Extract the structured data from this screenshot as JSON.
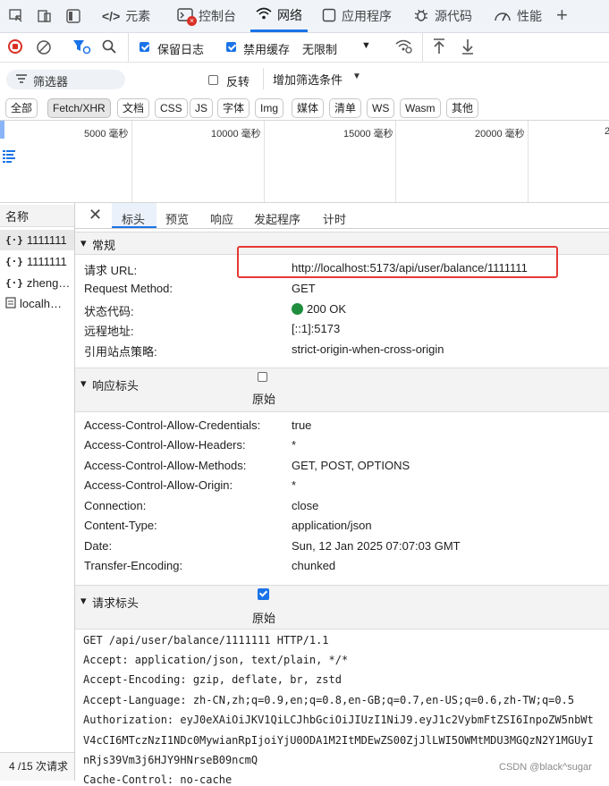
{
  "tabs": [
    {
      "label": "元素",
      "icon": "code-brackets-icon"
    },
    {
      "label": "控制台",
      "icon": "console-icon"
    },
    {
      "label": "网络",
      "icon": "wifi-icon"
    },
    {
      "label": "应用程序",
      "icon": "app-icon"
    },
    {
      "label": "源代码",
      "icon": "bug-icon"
    },
    {
      "label": "性能",
      "icon": "gauge-icon"
    }
  ],
  "toolbar": {
    "preserve_log": "保留日志",
    "disable_cache": "禁用缓存",
    "throttle": "无限制"
  },
  "filter": {
    "placeholder": "筛选器",
    "invert": "反转",
    "more": "增加筛选条件"
  },
  "types": [
    "全部",
    "Fetch/XHR",
    "文档",
    "CSS",
    "JS",
    "字体",
    "Img",
    "媒体",
    "清单",
    "WS",
    "Wasm",
    "其他"
  ],
  "timeline": {
    "ticks": [
      "5000 毫秒",
      "10000 毫秒",
      "15000 毫秒",
      "20000 毫秒",
      "2"
    ]
  },
  "left": {
    "header": "名称",
    "rows": [
      "1111111",
      "1111111",
      "zheng…",
      "localh…"
    ],
    "status": "4 /15 次请求"
  },
  "detail_tabs": [
    "标头",
    "预览",
    "响应",
    "发起程序",
    "计时"
  ],
  "general": {
    "title": "常规",
    "rows": [
      {
        "name": "请求 URL:",
        "value": "http://localhost:5173/api/user/balance/1111111"
      },
      {
        "name": "Request Method:",
        "value": "GET"
      },
      {
        "name": "状态代码:",
        "value": "200 OK"
      },
      {
        "name": "远程地址:",
        "value": "[::1]:5173"
      },
      {
        "name": "引用站点策略:",
        "value": "strict-origin-when-cross-origin"
      }
    ]
  },
  "response_headers": {
    "title": "响应标头",
    "raw_label": "原始",
    "rows": [
      {
        "name": "Access-Control-Allow-Credentials:",
        "value": "true"
      },
      {
        "name": "Access-Control-Allow-Headers:",
        "value": "*"
      },
      {
        "name": "Access-Control-Allow-Methods:",
        "value": "GET, POST, OPTIONS"
      },
      {
        "name": "Access-Control-Allow-Origin:",
        "value": "*"
      },
      {
        "name": "Connection:",
        "value": "close"
      },
      {
        "name": "Content-Type:",
        "value": "application/json"
      },
      {
        "name": "Date:",
        "value": "Sun, 12 Jan 2025 07:07:03 GMT"
      },
      {
        "name": "Transfer-Encoding:",
        "value": "chunked"
      }
    ]
  },
  "request_headers": {
    "title": "请求标头",
    "raw_label": "原始",
    "lines": [
      "GET /api/user/balance/1111111 HTTP/1.1",
      "Accept: application/json, text/plain, */*",
      "Accept-Encoding: gzip, deflate, br, zstd",
      "Accept-Language: zh-CN,zh;q=0.9,en;q=0.8,en-GB;q=0.7,en-US;q=0.6,zh-TW;q=0.5",
      "Authorization: eyJ0eXAiOiJKV1QiLCJhbGciOiJIUzI1NiJ9.eyJ1c2VybmFtZSI6InpoZW5nbWt",
      "V4cCI6MTczNzI1NDc0MywianRpIjoiYjU0ODA1M2ItMDEwZS00ZjJlLWI5OWMtMDU3MGQzN2Y1MGUyI",
      "nRjs39Vm3j6HJY9HNrseB09ncmQ",
      "Cache-Control: no-cache"
    ]
  },
  "watermark": "CSDN @black^sugar",
  "colors": {
    "accent": "#1a73e8",
    "status_ok": "#1e8e3e",
    "highlight_box": "#e53935"
  }
}
